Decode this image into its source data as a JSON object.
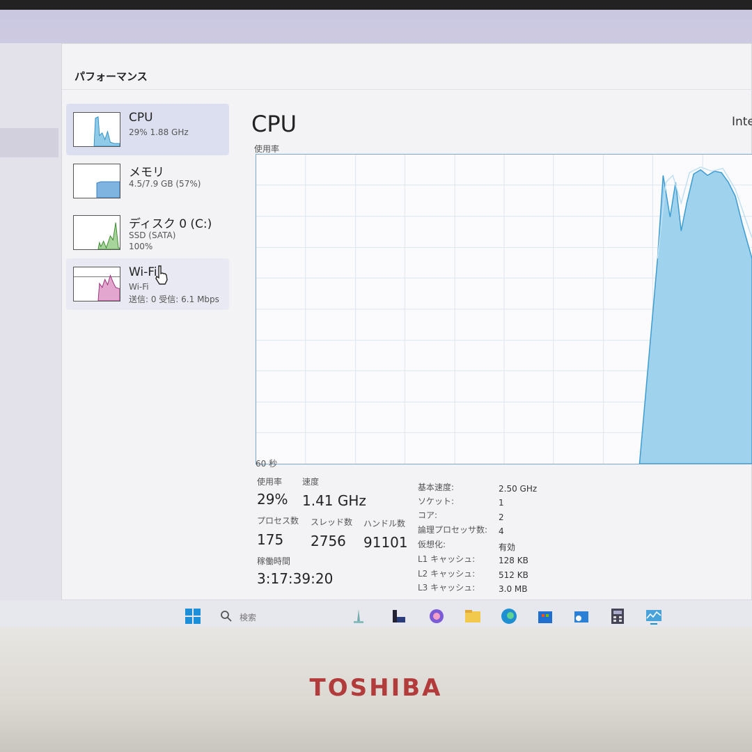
{
  "window": {
    "title": "パフォーマンス"
  },
  "sidebar": {
    "items": [
      {
        "name": "CPU",
        "sub1": "29% 1.88 GHz",
        "sub2": ""
      },
      {
        "name": "メモリ",
        "sub1": "4.5/7.9 GB (57%)",
        "sub2": ""
      },
      {
        "name": "ディスク 0 (C:)",
        "sub1": "SSD (SATA)",
        "sub2": "100%"
      },
      {
        "name": "Wi-Fi",
        "sub1": "Wi-Fi",
        "sub2": "送信: 0 受信: 6.1 Mbps"
      }
    ]
  },
  "main": {
    "title": "CPU",
    "model": "Inte",
    "usage_label": "使用率",
    "time_label": "60 秒",
    "stats": {
      "usage_label": "使用率",
      "usage_value": "29%",
      "speed_label": "速度",
      "speed_value": "1.41 GHz",
      "processes_label": "プロセス数",
      "processes_value": "175",
      "threads_label": "スレッド数",
      "threads_value": "2756",
      "handles_label": "ハンドル数",
      "handles_value": "91101",
      "uptime_label": "稼働時間",
      "uptime_value": "3:17:39:20"
    },
    "specs": [
      {
        "label": "基本速度:",
        "value": "2.50 GHz"
      },
      {
        "label": "ソケット:",
        "value": "1"
      },
      {
        "label": "コア:",
        "value": "2"
      },
      {
        "label": "論理プロセッサ数:",
        "value": "4"
      },
      {
        "label": "仮想化:",
        "value": "有効"
      },
      {
        "label": "L1 キャッシュ:",
        "value": "128 KB"
      },
      {
        "label": "L2 キャッシュ:",
        "value": "512 KB"
      },
      {
        "label": "L3 キャッシュ:",
        "value": "3.0 MB"
      }
    ]
  },
  "taskbar": {
    "search_label": "検索"
  },
  "laptop": {
    "brand": "TOSHIBA"
  },
  "colors": {
    "cpu_accent": "#4aa3d8",
    "memory_accent": "#4a8fcf",
    "disk_accent": "#4c9a3c",
    "wifi_accent": "#b0428c"
  }
}
